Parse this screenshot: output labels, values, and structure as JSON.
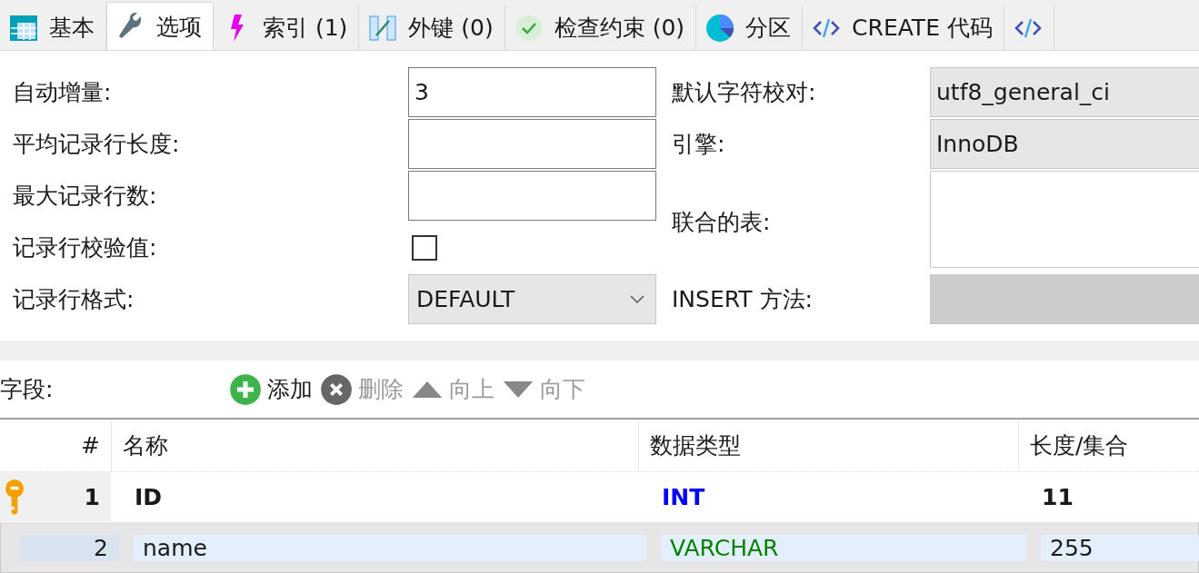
{
  "tabs": [
    {
      "label": "基本",
      "selected": false
    },
    {
      "label": "选项",
      "selected": true
    },
    {
      "label": "索引 (1)",
      "selected": false
    },
    {
      "label": "外键 (0)",
      "selected": false
    },
    {
      "label": "检查约束 (0)",
      "selected": false
    },
    {
      "label": "分区",
      "selected": false
    },
    {
      "label": "CREATE 代码",
      "selected": false
    },
    {
      "selected": false
    }
  ],
  "options": {
    "left": [
      {
        "label": "自动增量:",
        "kind": "input",
        "value": "3"
      },
      {
        "label": "平均记录行长度:",
        "kind": "input"
      },
      {
        "label": "最大记录行数:",
        "kind": "input"
      },
      {
        "label": "记录行校验值:",
        "kind": "checkbox",
        "checked": false
      },
      {
        "label": "记录行格式:",
        "kind": "select",
        "value": "DEFAULT"
      }
    ],
    "right": [
      {
        "label": "默认字符校对:",
        "kind": "readonly",
        "value": "utf8_general_ci"
      },
      {
        "label": "引擎:",
        "kind": "readonly",
        "value": "InnoDB"
      },
      {
        "label": "联合的表:",
        "kind": "textarea"
      },
      {
        "label": "INSERT 方法:",
        "kind": "disabled"
      }
    ]
  },
  "fields_toolbar": {
    "label": "字段:",
    "buttons": [
      {
        "label": "添加",
        "kind": "add",
        "disabled": false
      },
      {
        "label": "删除",
        "kind": "remove",
        "disabled": true
      },
      {
        "label": "向上",
        "kind": "up",
        "disabled": true
      },
      {
        "label": "向下",
        "kind": "down",
        "disabled": true
      }
    ]
  },
  "table": {
    "columns": [
      "#",
      "名称",
      "数据类型",
      "长度/集合"
    ],
    "rows": [
      {
        "number": "1",
        "primary_key": true,
        "selected": false,
        "name": "ID",
        "type": {
          "text": "INT",
          "color": "#0000ff"
        },
        "length": "11"
      },
      {
        "number": "2",
        "primary_key": false,
        "selected": true,
        "name": "name",
        "type": {
          "text": "VARCHAR",
          "color": "#008000"
        },
        "length": "255"
      }
    ]
  }
}
